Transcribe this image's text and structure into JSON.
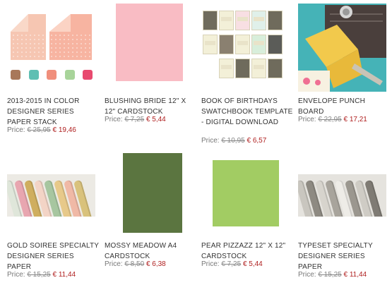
{
  "price_label": "Price:",
  "products": [
    {
      "name": "2013-2015 In Color Designer Series Paper Stack",
      "old_price": "€ 25,95",
      "new_price": "€ 19,46",
      "colors": [
        "#a8785a",
        "#5fbfb3",
        "#f08f7c",
        "#a8d49a",
        "#e84a6f"
      ]
    },
    {
      "name": "Blushing Bride 12\" x 12\" Cardstock",
      "old_price": "€ 7,25",
      "new_price": "€ 5,44",
      "colors": [
        "#f9bcc4"
      ]
    },
    {
      "name": "Book of Birthdays Swatchbook Template - Digital Download",
      "old_price": "€ 10,95",
      "new_price": "€ 6,57",
      "colors": [
        "#6f6b5c",
        "#f3f0d8"
      ]
    },
    {
      "name": "Envelope Punch Board",
      "old_price": "€ 22,95",
      "new_price": "€ 17,21",
      "colors": [
        "#3fb0b4",
        "#f2c94c",
        "#4a3f3c"
      ]
    },
    {
      "name": "Gold Soiree Specialty Designer Series Paper",
      "old_price": "€ 15,25",
      "new_price": "€ 11,44",
      "colors": [
        "#e8a6b0",
        "#cfae5f",
        "#a7c6a0"
      ]
    },
    {
      "name": "Mossy Meadow A4 Cardstock",
      "old_price": "€ 8,50",
      "new_price": "€ 6,38",
      "colors": [
        "#5b7540"
      ]
    },
    {
      "name": "Pear Pizzazz 12\" x 12\" Cardstock",
      "old_price": "€ 7,25",
      "new_price": "€ 5,44",
      "colors": [
        "#a2cc63"
      ]
    },
    {
      "name": "Typeset Specialty Designer Series Paper",
      "old_price": "€ 15,25",
      "new_price": "€ 11,44",
      "colors": [
        "#d7d4cd",
        "#8e8a82"
      ]
    }
  ]
}
